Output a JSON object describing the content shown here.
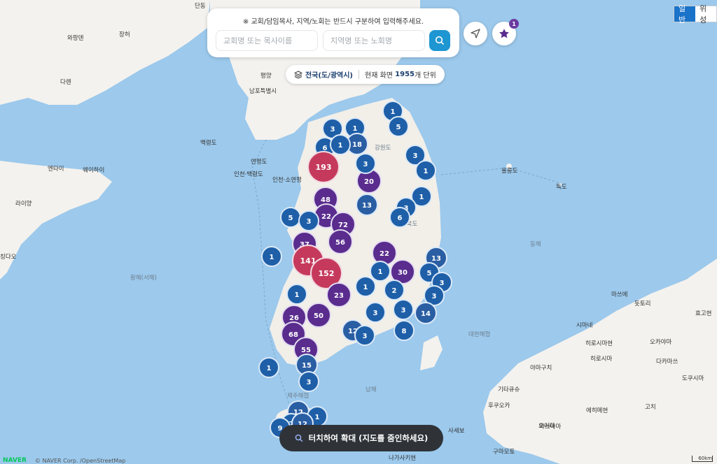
{
  "search": {
    "notice": "※ 교회/담임목사, 지역/노회는 반드시 구분하여 입력해주세요.",
    "church_placeholder": "교회명 또는 목사이름",
    "region_placeholder": "지역명 또는 노회명"
  },
  "favorites": {
    "count": "1"
  },
  "region_bar": {
    "region": "전국(도/광역시)",
    "current": "현재 화면",
    "count": "1955",
    "unit": "개 단위"
  },
  "map_type": {
    "normal": "일반",
    "satellite": "위성"
  },
  "bottom": {
    "zoom_hint": "터치하여 확대 (지도를 줌인하세요)"
  },
  "attribution": {
    "brand": "NAVER",
    "copyright": "© NAVER Corp. /OpenStreetMap",
    "scale": "60km"
  },
  "colors": {
    "low": "#1e5fa8",
    "mid": "#5a2c8e",
    "high": "#c53a5c",
    "sea": "#9cc9ec",
    "land": "#f4f2ee"
  },
  "places": [
    {
      "name": "단동"
    },
    {
      "name": "와팡덴"
    },
    {
      "name": "장허"
    },
    {
      "name": "다롄"
    },
    {
      "name": "평양"
    },
    {
      "name": "남포특별시"
    },
    {
      "name": "백령도"
    },
    {
      "name": "연평도"
    },
    {
      "name": "엔타이"
    },
    {
      "name": "웨이하이"
    },
    {
      "name": "라이양"
    },
    {
      "name": "칭다오"
    },
    {
      "name": "황해(서해)"
    },
    {
      "name": "강원도"
    },
    {
      "name": "울릉도"
    },
    {
      "name": "독도"
    },
    {
      "name": "경상북도"
    },
    {
      "name": "동해"
    },
    {
      "name": "대한해협"
    },
    {
      "name": "제주해협"
    },
    {
      "name": "남해"
    },
    {
      "name": "마쓰에"
    },
    {
      "name": "돗토리"
    },
    {
      "name": "효고현"
    },
    {
      "name": "시마네"
    },
    {
      "name": "히로시마현"
    },
    {
      "name": "오카야마"
    },
    {
      "name": "히로시마"
    },
    {
      "name": "다카마쓰"
    },
    {
      "name": "야마구치"
    },
    {
      "name": "도쿠시마"
    },
    {
      "name": "기타큐슈"
    },
    {
      "name": "후쿠오카"
    },
    {
      "name": "마쓰야마"
    },
    {
      "name": "에히메현"
    },
    {
      "name": "고치"
    },
    {
      "name": "사세보"
    },
    {
      "name": "오이타"
    },
    {
      "name": "구마모토"
    },
    {
      "name": "나가사키현"
    },
    {
      "name": "인천·백령도"
    },
    {
      "name": "인천·소연평"
    }
  ],
  "clusters": [
    {
      "count": "1"
    },
    {
      "count": "5"
    },
    {
      "count": "3"
    },
    {
      "count": "1"
    },
    {
      "count": "18"
    },
    {
      "count": "6"
    },
    {
      "count": "3"
    },
    {
      "count": "1"
    },
    {
      "count": "193"
    },
    {
      "count": "20"
    },
    {
      "count": "3"
    },
    {
      "count": "1"
    },
    {
      "count": "48"
    },
    {
      "count": "13"
    },
    {
      "count": "1"
    },
    {
      "count": "3"
    },
    {
      "count": "5"
    },
    {
      "count": "22"
    },
    {
      "count": "3"
    },
    {
      "count": "6"
    },
    {
      "count": "72"
    },
    {
      "count": "37"
    },
    {
      "count": "56"
    },
    {
      "count": "1"
    },
    {
      "count": "22"
    },
    {
      "count": "141"
    },
    {
      "count": "152"
    },
    {
      "count": "13"
    },
    {
      "count": "30"
    },
    {
      "count": "5"
    },
    {
      "count": "1"
    },
    {
      "count": "3"
    },
    {
      "count": "1"
    },
    {
      "count": "23"
    },
    {
      "count": "1"
    },
    {
      "count": "2"
    },
    {
      "count": "3"
    },
    {
      "count": "50"
    },
    {
      "count": "26"
    },
    {
      "count": "3"
    },
    {
      "count": "3"
    },
    {
      "count": "14"
    },
    {
      "count": "12"
    },
    {
      "count": "3"
    },
    {
      "count": "8"
    },
    {
      "count": "68"
    },
    {
      "count": "55"
    },
    {
      "count": "15"
    },
    {
      "count": "1"
    },
    {
      "count": "12"
    },
    {
      "count": "1"
    },
    {
      "count": "7"
    },
    {
      "count": "12"
    },
    {
      "count": "9"
    },
    {
      "count": "3"
    }
  ]
}
